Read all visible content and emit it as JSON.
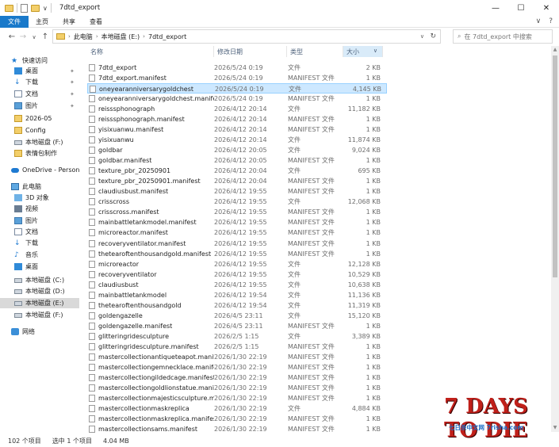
{
  "window": {
    "title": "7dtd_export",
    "controls": {
      "minimize": "—",
      "maximize": "☐",
      "close": "✕"
    }
  },
  "ribbon": {
    "tabs": [
      "文件",
      "主页",
      "共享",
      "查看"
    ],
    "expand_icon": "∨",
    "help_icon": "?"
  },
  "address": {
    "crumbs": [
      "此电脑",
      "本地磁盘 (E:)",
      "7dtd_export"
    ],
    "search_placeholder": "在 7dtd_export 中搜索"
  },
  "nav": {
    "quick_access": "快速访问",
    "items": [
      {
        "label": "快速访问",
        "icon": "star-icon",
        "pinned": false
      },
      {
        "label": "桌面",
        "icon": "desktop-icon",
        "pinned": true
      },
      {
        "label": "下载",
        "icon": "download-icon",
        "pinned": true
      },
      {
        "label": "文档",
        "icon": "documents-icon",
        "pinned": true
      },
      {
        "label": "图片",
        "icon": "pictures-icon",
        "pinned": true
      },
      {
        "label": "2026-05",
        "icon": "folder-icon",
        "pinned": false
      },
      {
        "label": "Config",
        "icon": "folder-icon",
        "pinned": false
      },
      {
        "label": "本地磁盘 (F:)",
        "icon": "drive-icon",
        "pinned": false
      },
      {
        "label": "表情包制作",
        "icon": "folder-icon",
        "pinned": false
      },
      {
        "label": "OneDrive - Persona",
        "icon": "onedrive-icon",
        "pinned": false
      },
      {
        "label": "此电脑",
        "icon": "pc-icon",
        "pinned": false
      },
      {
        "label": "3D 对象",
        "icon": "3d-icon",
        "pinned": false
      },
      {
        "label": "视频",
        "icon": "video-icon",
        "pinned": false
      },
      {
        "label": "图片",
        "icon": "pictures-icon",
        "pinned": false
      },
      {
        "label": "文档",
        "icon": "documents-icon",
        "pinned": false
      },
      {
        "label": "下载",
        "icon": "download-icon",
        "pinned": false
      },
      {
        "label": "音乐",
        "icon": "music-icon",
        "pinned": false
      },
      {
        "label": "桌面",
        "icon": "desktop-icon",
        "pinned": false
      },
      {
        "label": "本地磁盘 (C:)",
        "icon": "drive-icon",
        "pinned": false
      },
      {
        "label": "本地磁盘 (D:)",
        "icon": "drive-icon",
        "pinned": false
      },
      {
        "label": "本地磁盘 (E:)",
        "icon": "drive-icon",
        "pinned": false,
        "selected": true
      },
      {
        "label": "本地磁盘 (F:)",
        "icon": "drive-icon",
        "pinned": false
      },
      {
        "label": "网络",
        "icon": "network-icon",
        "pinned": false
      }
    ]
  },
  "columns": {
    "name": "名称",
    "date": "修改日期",
    "type": "类型",
    "size": "大小"
  },
  "files": [
    {
      "name": "7dtd_export",
      "date": "2026/5/24 0:19",
      "type": "文件",
      "size": "2 KB"
    },
    {
      "name": "7dtd_export.manifest",
      "date": "2026/5/24 0:19",
      "type": "MANIFEST 文件",
      "size": "1 KB"
    },
    {
      "name": "oneyearanniversarygoldchest",
      "date": "2026/5/24 0:19",
      "type": "文件",
      "size": "4,145 KB",
      "selected": true
    },
    {
      "name": "oneyearanniversarygoldchest.manifest",
      "date": "2026/5/24 0:19",
      "type": "MANIFEST 文件",
      "size": "1 KB"
    },
    {
      "name": "reisssphonograph",
      "date": "2026/4/12 20:14",
      "type": "文件",
      "size": "11,182 KB"
    },
    {
      "name": "reisssphonograph.manifest",
      "date": "2026/4/12 20:14",
      "type": "MANIFEST 文件",
      "size": "1 KB"
    },
    {
      "name": "yisixuanwu.manifest",
      "date": "2026/4/12 20:14",
      "type": "MANIFEST 文件",
      "size": "1 KB"
    },
    {
      "name": "yisixuanwu",
      "date": "2026/4/12 20:14",
      "type": "文件",
      "size": "11,874 KB"
    },
    {
      "name": "goldbar",
      "date": "2026/4/12 20:05",
      "type": "文件",
      "size": "9,024 KB"
    },
    {
      "name": "goldbar.manifest",
      "date": "2026/4/12 20:05",
      "type": "MANIFEST 文件",
      "size": "1 KB"
    },
    {
      "name": "texture_pbr_20250901",
      "date": "2026/4/12 20:04",
      "type": "文件",
      "size": "695 KB"
    },
    {
      "name": "texture_pbr_20250901.manifest",
      "date": "2026/4/12 20:04",
      "type": "MANIFEST 文件",
      "size": "1 KB"
    },
    {
      "name": "claudiusbust.manifest",
      "date": "2026/4/12 19:55",
      "type": "MANIFEST 文件",
      "size": "1 KB"
    },
    {
      "name": "crisscross",
      "date": "2026/4/12 19:55",
      "type": "文件",
      "size": "12,068 KB"
    },
    {
      "name": "crisscross.manifest",
      "date": "2026/4/12 19:55",
      "type": "MANIFEST 文件",
      "size": "1 KB"
    },
    {
      "name": "mainbattletankmodel.manifest",
      "date": "2026/4/12 19:55",
      "type": "MANIFEST 文件",
      "size": "1 KB"
    },
    {
      "name": "microreactor.manifest",
      "date": "2026/4/12 19:55",
      "type": "MANIFEST 文件",
      "size": "1 KB"
    },
    {
      "name": "recoveryventilator.manifest",
      "date": "2026/4/12 19:55",
      "type": "MANIFEST 文件",
      "size": "1 KB"
    },
    {
      "name": "thetearoftenthousandgold.manifest",
      "date": "2026/4/12 19:55",
      "type": "MANIFEST 文件",
      "size": "1 KB"
    },
    {
      "name": "microreactor",
      "date": "2026/4/12 19:55",
      "type": "文件",
      "size": "12,128 KB"
    },
    {
      "name": "recoveryventilator",
      "date": "2026/4/12 19:55",
      "type": "文件",
      "size": "10,529 KB"
    },
    {
      "name": "claudiusbust",
      "date": "2026/4/12 19:55",
      "type": "文件",
      "size": "10,638 KB"
    },
    {
      "name": "mainbattletankmodel",
      "date": "2026/4/12 19:54",
      "type": "文件",
      "size": "11,136 KB"
    },
    {
      "name": "thetearoftenthousandgold",
      "date": "2026/4/12 19:54",
      "type": "文件",
      "size": "11,319 KB"
    },
    {
      "name": "goldengazelle",
      "date": "2026/4/5 23:11",
      "type": "文件",
      "size": "15,120 KB"
    },
    {
      "name": "goldengazelle.manifest",
      "date": "2026/4/5 23:11",
      "type": "MANIFEST 文件",
      "size": "1 KB"
    },
    {
      "name": "glitteringridesculpture",
      "date": "2026/2/5 1:15",
      "type": "文件",
      "size": "3,389 KB"
    },
    {
      "name": "glitteringridesculpture.manifest",
      "date": "2026/2/5 1:15",
      "type": "MANIFEST 文件",
      "size": "1 KB"
    },
    {
      "name": "mastercollectionantiqueteapot.manif...",
      "date": "2026/1/30 22:19",
      "type": "MANIFEST 文件",
      "size": "1 KB"
    },
    {
      "name": "mastercollectiongemnecklace.manifest",
      "date": "2026/1/30 22:19",
      "type": "MANIFEST 文件",
      "size": "1 KB"
    },
    {
      "name": "mastercollectiongildedcage.manifest",
      "date": "2026/1/30 22:19",
      "type": "MANIFEST 文件",
      "size": "1 KB"
    },
    {
      "name": "mastercollectiongoldlionstatue.manif...",
      "date": "2026/1/30 22:19",
      "type": "MANIFEST 文件",
      "size": "1 KB"
    },
    {
      "name": "mastercollectionmajesticsculpture.ma...",
      "date": "2026/1/30 22:19",
      "type": "MANIFEST 文件",
      "size": "1 KB"
    },
    {
      "name": "mastercollectionmaskreplica",
      "date": "2026/1/30 22:19",
      "type": "文件",
      "size": "4,884 KB"
    },
    {
      "name": "mastercollectionmaskreplica.manifest",
      "date": "2026/1/30 22:19",
      "type": "MANIFEST 文件",
      "size": "1 KB"
    },
    {
      "name": "mastercollectionsams.manifest",
      "date": "2026/1/30 22:19",
      "type": "MANIFEST 文件",
      "size": "1 KB"
    }
  ],
  "status": {
    "count": "102 个项目",
    "selected": "选中 1 个项目",
    "size": "4.04 MB"
  },
  "watermark": {
    "big": "7 DAYS TO DIE",
    "small": "七日杀中文网 7risha.com"
  }
}
